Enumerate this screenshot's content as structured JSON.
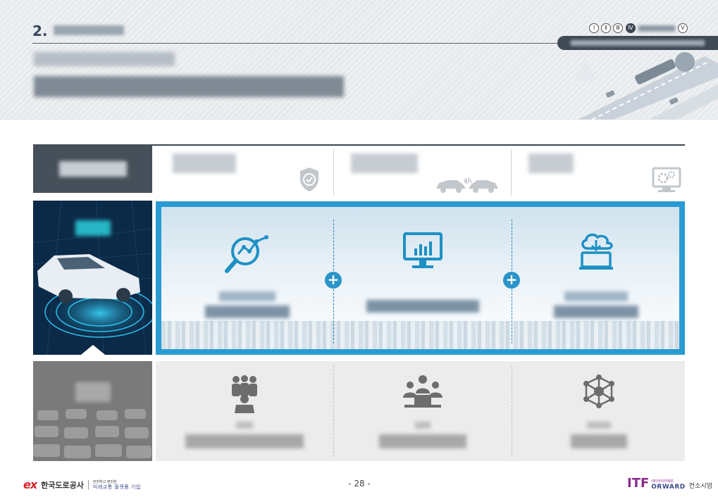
{
  "header": {
    "section_number": "2.",
    "roman_nav": [
      "Ⅰ",
      "Ⅱ",
      "Ⅲ",
      "Ⅳ",
      "Ⅴ"
    ],
    "active_index": 3
  },
  "top_row": {
    "icons": [
      "shield-check-icon",
      "car-collision-icon",
      "monitor-gears-icon"
    ]
  },
  "middle_row": {
    "icons": [
      "magnify-chart-icon",
      "monitor-chart-icon",
      "cloud-laptop-icon"
    ],
    "connector": "+"
  },
  "bottom_row": {
    "icons": [
      "people-group-icon",
      "meeting-laptop-icon",
      "network-hub-icon"
    ]
  },
  "colors": {
    "accent_blue": "#2a9ad2",
    "dark_slate": "#46505a",
    "teal": "#27b6c4",
    "brand_red": "#d8232a",
    "brand_purple": "#8b2b8f"
  },
  "footer": {
    "ex_logo": "ex",
    "company": "한국도로공사",
    "slogan_small": "안전하고 편리한",
    "slogan": "미래교통 플랫폼 기업",
    "page_number": "- 28 -",
    "itf": "ITF",
    "itf_small": "(주)아이티에프",
    "itf_word": "ORWARD",
    "consulting": "컨소시엄"
  }
}
